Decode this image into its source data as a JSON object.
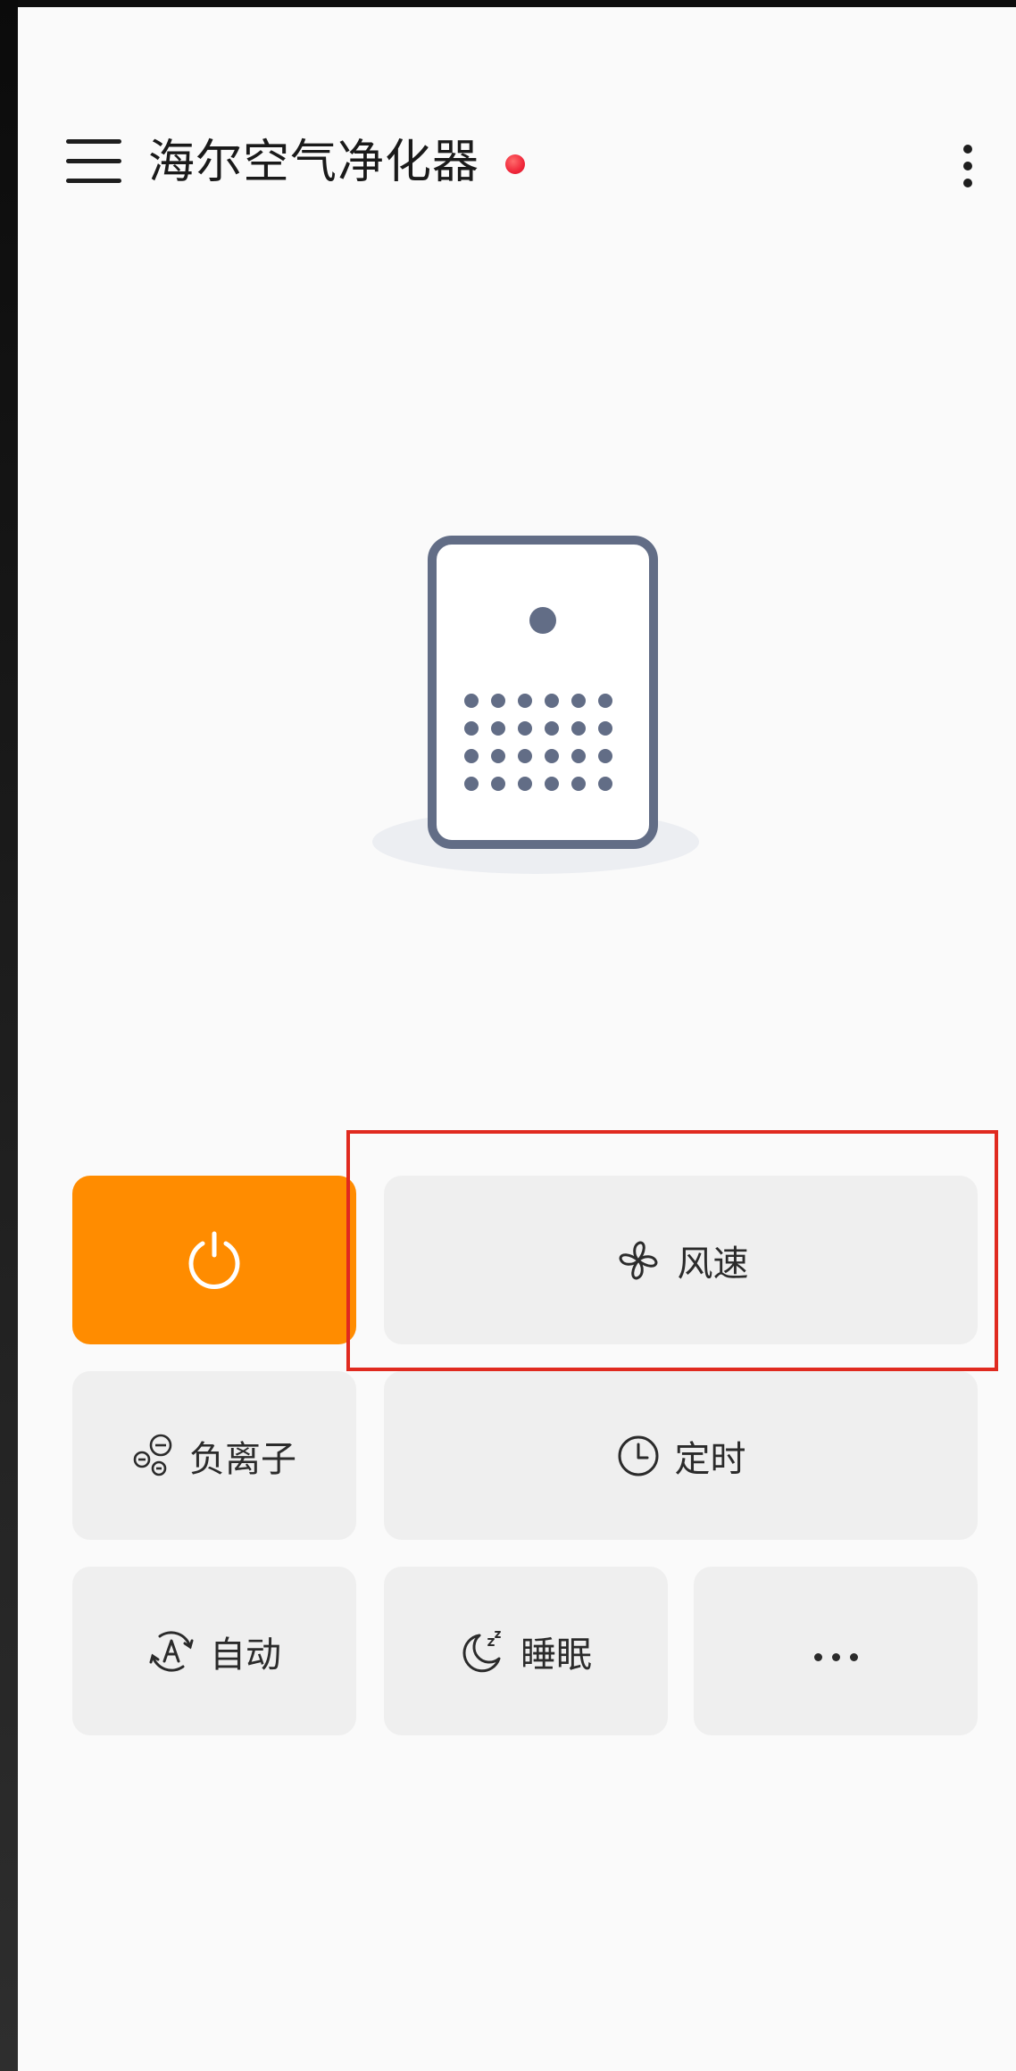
{
  "header": {
    "title": "海尔空气净化器",
    "status_color": "#f0273a"
  },
  "controls": {
    "power": {
      "icon": "power-icon",
      "color": "#ff8c00"
    },
    "wind_speed": {
      "label": "风速",
      "icon": "fan-icon"
    },
    "negative_ion": {
      "label": "负离子",
      "icon": "ion-icon"
    },
    "timer": {
      "label": "定时",
      "icon": "clock-icon"
    },
    "auto": {
      "label": "自动",
      "icon": "auto-mode-icon"
    },
    "sleep": {
      "label": "睡眠",
      "icon": "moon-sleep-icon"
    },
    "more": {
      "icon": "ellipsis-icon"
    }
  },
  "highlight": {
    "target": "wind_speed",
    "color": "#e02a1f"
  }
}
